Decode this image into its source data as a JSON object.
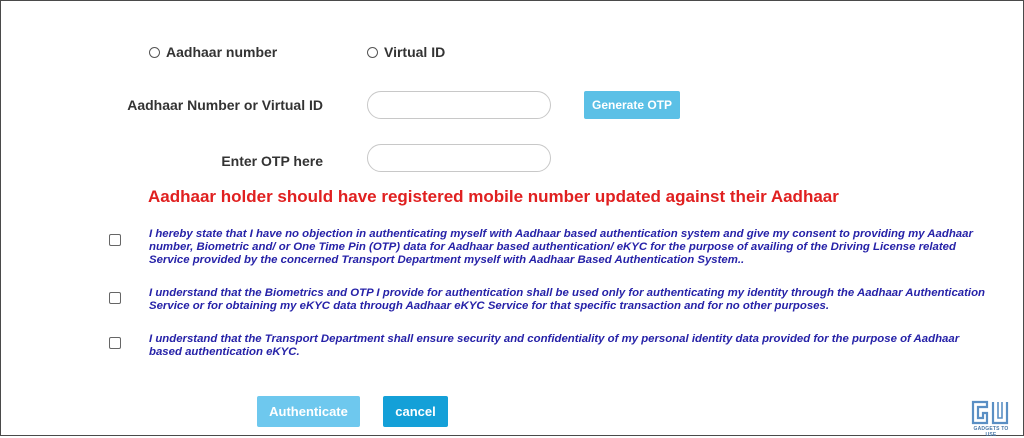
{
  "id_type": {
    "options": [
      {
        "label": "Aadhaar number"
      },
      {
        "label": "Virtual ID"
      }
    ]
  },
  "form": {
    "id_label": "Aadhaar Number or Virtual ID",
    "id_value": "",
    "otp_label": "Enter OTP here",
    "otp_value": "",
    "generate_otp_label": "Generate OTP"
  },
  "notice": "Aadhaar holder should have registered mobile number updated against their Aadhaar",
  "consents": [
    {
      "text": "I hereby state that I have no objection in authenticating myself with Aadhaar based authentication system and give my consent to providing my Aadhaar number, Biometric and/ or One Time Pin (OTP) data for Aadhaar based authentication/ eKYC for the purpose of availing of the Driving License related Service provided by the concerned Transport Department myself with Aadhaar Based Authentication System.."
    },
    {
      "text": "I understand that the Biometrics and OTP I provide for authentication shall be used only for authenticating my identity through the Aadhaar Authentication Service or for obtaining my eKYC data through Aadhaar eKYC Service for that specific transaction and for no other purposes."
    },
    {
      "text": "I understand that the Transport Department shall ensure security and confidentiality of my personal identity data provided for the purpose of Aadhaar based authentication eKYC."
    }
  ],
  "actions": {
    "authenticate_label": "Authenticate",
    "cancel_label": "cancel"
  },
  "watermark": {
    "logo_text": "GU",
    "tagline": "GADGETS TO USE"
  },
  "colors": {
    "notice": "#e02020",
    "consent_text": "#2622a8",
    "generate_otp_bg": "#5bc0e6",
    "authenticate_bg": "#6ec8ee",
    "cancel_bg": "#14a0d8"
  }
}
